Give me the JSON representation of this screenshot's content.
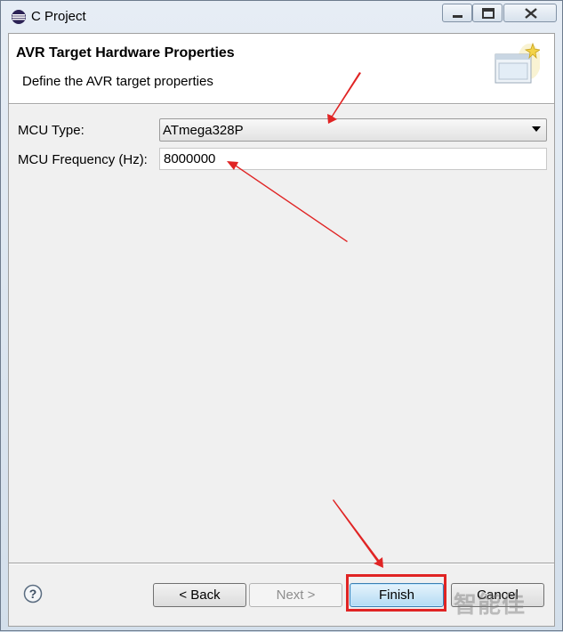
{
  "window": {
    "title": "C Project"
  },
  "header": {
    "title": "AVR Target Hardware Properties",
    "description": "Define the AVR target properties"
  },
  "form": {
    "mcu_type_label": "MCU Type:",
    "mcu_type_value": "ATmega328P",
    "mcu_frequency_label": "MCU Frequency (Hz):",
    "mcu_frequency_value": "8000000"
  },
  "buttons": {
    "back": "< Back",
    "next": "Next >",
    "finish": "Finish",
    "cancel": "Cancel"
  },
  "icons": {
    "app": "eclipse-icon",
    "help": "help-icon",
    "wizard": "wizard-banner-icon"
  },
  "colors": {
    "annotation_red": "#e02424",
    "finish_accent": "#3c7fb1"
  },
  "watermark": "智能佳"
}
